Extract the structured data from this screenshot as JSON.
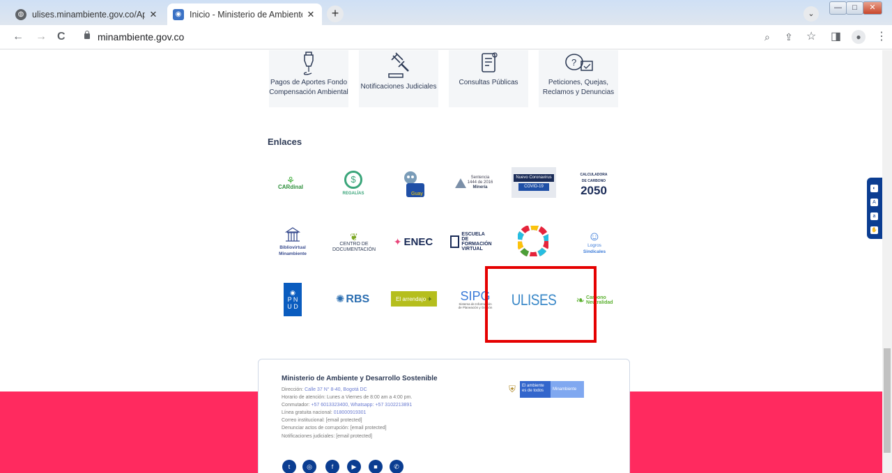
{
  "browser": {
    "tabs": [
      {
        "title": "ulises.minambiente.gov.co/Aprob",
        "close": "✕",
        "icon": "globe-icon"
      },
      {
        "title": "Inicio - Ministerio de Ambiente y",
        "close": "✕",
        "icon": "site-favicon-icon"
      }
    ],
    "new_tab": "+",
    "window_buttons": {
      "minimize": "—",
      "maximize": "□",
      "close": "✕"
    },
    "url": "minambiente.gov.co",
    "nav": {
      "back": "←",
      "forward": "→",
      "reload": "C"
    }
  },
  "services": [
    {
      "label": "Pagos de Aportes Fondo Compensación Ambiental",
      "icon": "pen-icon"
    },
    {
      "label": "Notificaciones Judiciales",
      "icon": "gavel-icon"
    },
    {
      "label": "Consultas Públicas",
      "icon": "scroll-icon"
    },
    {
      "label": "Peticiones, Quejas, Reclamos y Denuncias",
      "icon": "chat-question-icon"
    }
  ],
  "enlaces": {
    "title": "Enlaces",
    "logos": [
      {
        "name": "CARdinal",
        "icon": "cardinal-logo"
      },
      {
        "name": "REGALÍAS",
        "icon": "regalias-logo"
      },
      {
        "name": "Ámbito Guay",
        "icon": "mascot-logo"
      },
      {
        "name": "Sentencia 1444 de 2016 Minería",
        "icon": "mineria-logo"
      },
      {
        "name": "Nuevo Coronavirus COVID-19",
        "icon": "covid-logo"
      },
      {
        "name": "CALCULADORA DE CARBONO 2050",
        "icon": "calculadora-logo"
      },
      {
        "name": "Bibliovirtual Minambiente",
        "icon": "bibliovirtual-logo"
      },
      {
        "name": "CENTRO DE DOCUMENTACIÓN",
        "icon": "centro-logo"
      },
      {
        "name": "ENEC",
        "icon": "enec-logo"
      },
      {
        "name": "ESCUELA DE FORMACIÓN VIRTUAL",
        "icon": "escuela-logo"
      },
      {
        "name": "ODS",
        "icon": "ods-wheel-logo"
      },
      {
        "name": "Logros Sindicales",
        "icon": "logros-logo"
      },
      {
        "name": "PNUD",
        "icon": "pnud-logo"
      },
      {
        "name": "RBS",
        "icon": "rbs-logo"
      },
      {
        "name": "El arrendajo",
        "icon": "arrendajo-logo"
      },
      {
        "name": "SIPG",
        "icon": "sipg-logo"
      },
      {
        "name": "ULISES",
        "icon": "ulises-logo"
      },
      {
        "name": "Programa Nacional Carbono Neutralidad",
        "icon": "carbono-neutralidad-logo"
      }
    ]
  },
  "footer": {
    "title": "Ministerio de Ambiente y Desarrollo Sostenible",
    "lines": [
      {
        "label": "Dirección: ",
        "value": "Calle 37 N° 8-40, Bogotá DC"
      },
      {
        "label": "Horario de atención: Lunes a Viernes de 8:00 am a 4:00 pm.",
        "value": ""
      },
      {
        "label": "Conmutador: ",
        "value": "+57 6013323400, Whatsapp: +57 3102213891"
      },
      {
        "label": "Línea gratuita nacional: ",
        "value": "018000919301"
      },
      {
        "label": "Correo institucional: [email protected]",
        "value": ""
      },
      {
        "label": "Denunciar actos de corrupción: [email protected]",
        "value": ""
      },
      {
        "label": "Notificaciones judiciales: [email protected]",
        "value": ""
      }
    ],
    "gov_logo": {
      "line1": "El ambiente",
      "line2": "es de todos",
      "brand": "Minambiente"
    },
    "social": [
      "twitter-icon",
      "instagram-icon",
      "facebook-icon",
      "youtube-icon",
      "flickr-icon",
      "whatsapp-icon"
    ]
  },
  "colors": {
    "accent": "#0b3d91",
    "pink": "#ff2a5f",
    "highlight": "#e50000"
  }
}
